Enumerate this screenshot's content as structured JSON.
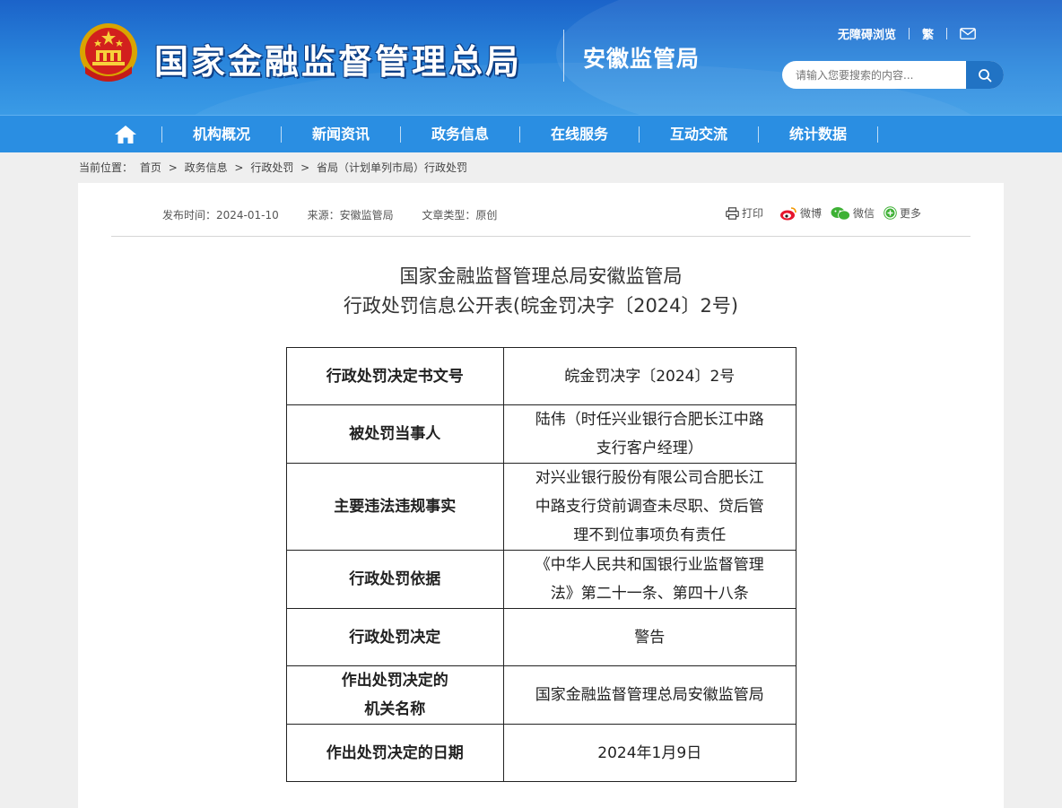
{
  "header": {
    "site_title": "国家金融监督管理总局",
    "sub_title": "安徽监管局",
    "links": {
      "accessibility": "无障碍浏览",
      "traditional": "繁"
    },
    "search_placeholder": "请输入您要搜索的内容..."
  },
  "nav": {
    "items": [
      "机构概况",
      "新闻资讯",
      "政务信息",
      "在线服务",
      "互动交流",
      "统计数据"
    ]
  },
  "breadcrumb": {
    "label": "当前位置：",
    "items": [
      "首页",
      "政务信息",
      "行政处罚",
      "省局（计划单列市局）行政处罚"
    ],
    "separator": ">"
  },
  "meta": {
    "publish": "发布时间：2024-01-10",
    "source": "来源：安徽监管局",
    "type": "文章类型：原创"
  },
  "share": {
    "print": "打印",
    "weibo": "微博",
    "wechat": "微信",
    "more": "更多"
  },
  "document": {
    "title_line1": "国家金融监督管理总局安徽监管局",
    "title_line2": "行政处罚信息公开表(皖金罚决字〔2024〕2号)",
    "rows": [
      {
        "k1": "行政处罚决定书文号",
        "k2": "",
        "v1": "皖金罚决字〔2024〕2号",
        "v2": "",
        "v3": ""
      },
      {
        "k1": "被处罚当事人",
        "k2": "",
        "v1": "陆伟（时任兴业银行合肥长江中路",
        "v2": "支行客户经理）",
        "v3": ""
      },
      {
        "k1": "主要违法违规事实",
        "k2": "",
        "v1": "对兴业银行股份有限公司合肥长江",
        "v2": "中路支行贷前调查未尽职、贷后管",
        "v3": "理不到位事项负有责任"
      },
      {
        "k1": "行政处罚依据",
        "k2": "",
        "v1": "《中华人民共和国银行业监督管理",
        "v2": "法》第二十一条、第四十八条",
        "v3": ""
      },
      {
        "k1": "行政处罚决定",
        "k2": "",
        "v1": "警告",
        "v2": "",
        "v3": ""
      },
      {
        "k1": "作出处罚决定的",
        "k2": "机关名称",
        "v1": "国家金融监督管理总局安徽监管局",
        "v2": "",
        "v3": ""
      },
      {
        "k1": "作出处罚决定的日期",
        "k2": "",
        "v1": "2024年1月9日",
        "v2": "",
        "v3": ""
      }
    ]
  },
  "colors": {
    "header_blue": "#1b63c9",
    "nav_blue": "#2a8ee2",
    "search_button": "#2173c4"
  }
}
